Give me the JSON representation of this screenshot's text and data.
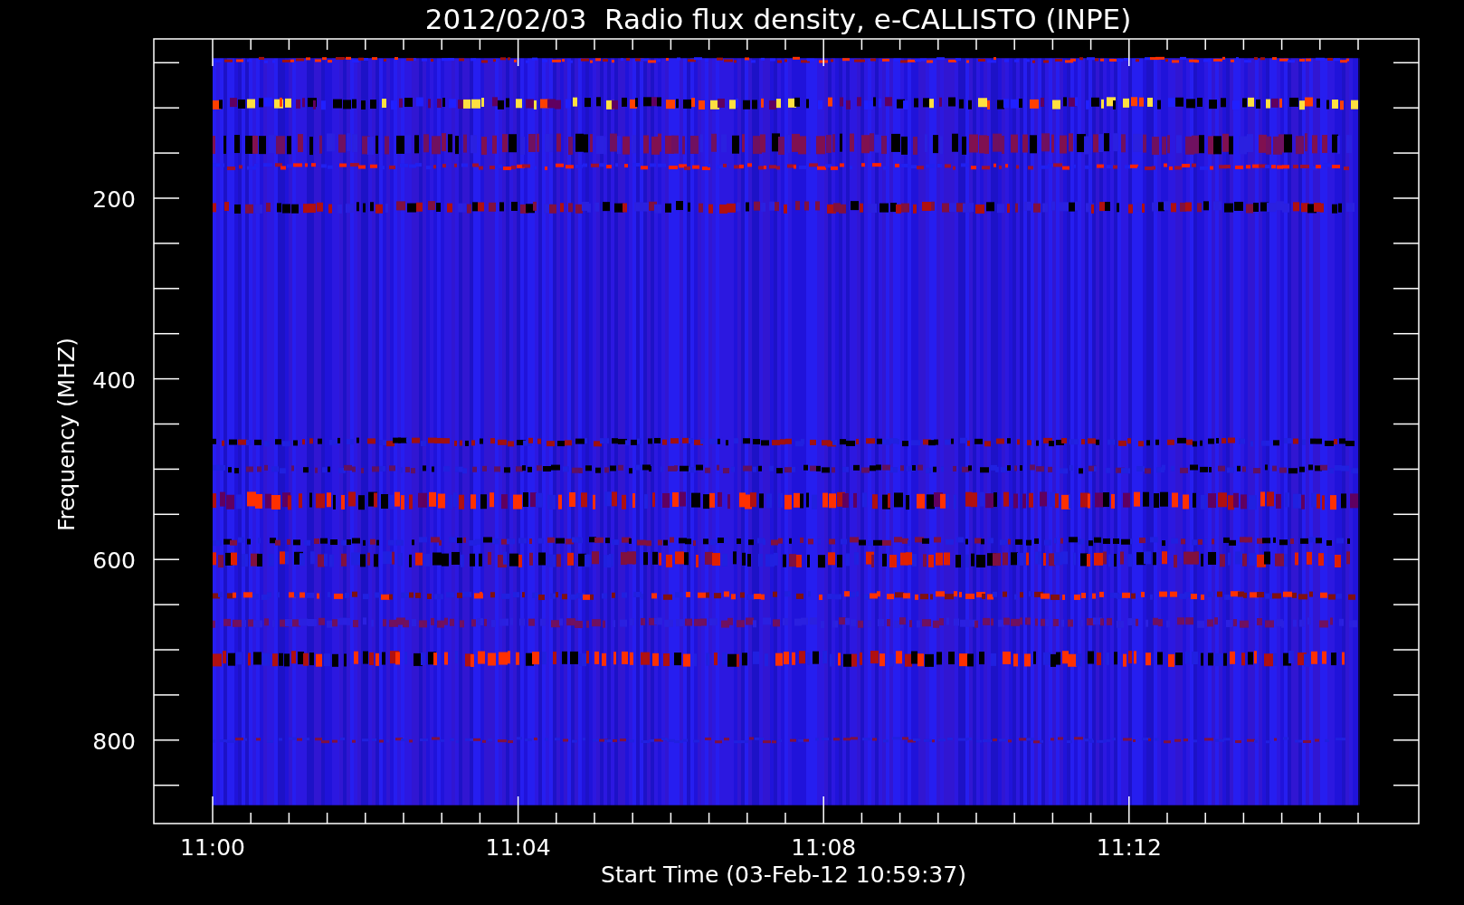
{
  "title": "2012/02/03  Radio flux density, e-CALLISTO (INPE)",
  "chart": {
    "ylabel": "Frequency (MHZ)",
    "xlabel": "Start Time (03-Feb-12 10:59:37)",
    "yticks": [
      "200",
      "400",
      "600",
      "800"
    ],
    "xticks": [
      "11:00",
      "11:04",
      "11:08",
      "11:12"
    ]
  }
}
